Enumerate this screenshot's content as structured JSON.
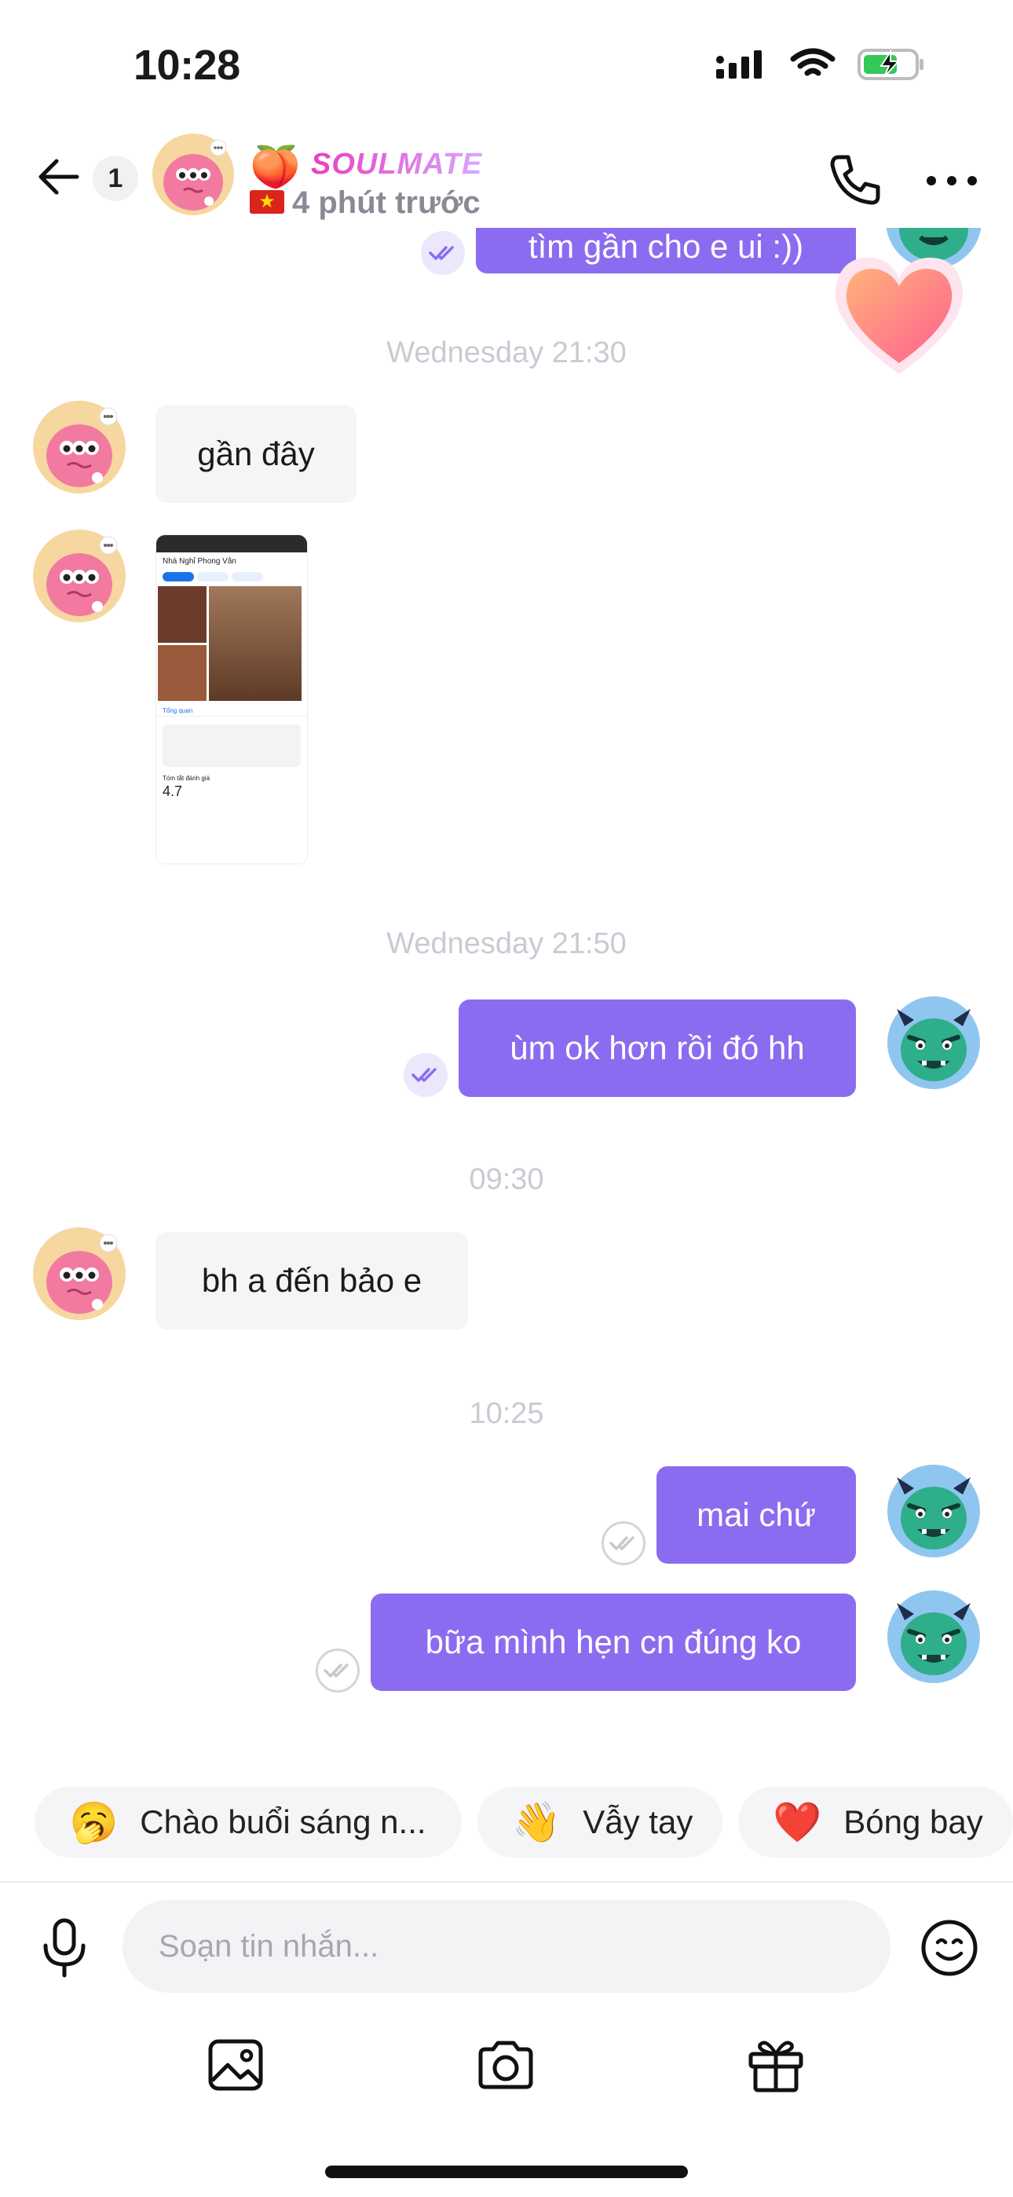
{
  "status_bar": {
    "time": "10:28"
  },
  "header": {
    "unread_count": "1",
    "app_brand": "SOULMATE",
    "peach_emoji": "🍑",
    "flag_emoji": "★",
    "last_seen": "4 phút trước"
  },
  "messages": {
    "partial_top_text": "tìm gần cho e ui :))",
    "timestamp_1": "Wednesday 21:30",
    "in_1": "gần đây",
    "shared_image": {
      "place_name": "Nhà Nghỉ Phong Vân",
      "rating": "4.7",
      "tab_overview": "Tổng quan",
      "section_reviews": "Tóm tắt đánh giá"
    },
    "timestamp_2": "Wednesday 21:50",
    "out_1": "ùm ok hơn rồi đó hh",
    "timestamp_3": "09:30",
    "in_2": "bh a đến bảo e",
    "timestamp_4": "10:25",
    "out_2": "mai chứ",
    "out_3": "bữa mình hẹn cn đúng ko"
  },
  "suggestions": [
    {
      "emoji": "🥱",
      "label": "Chào buổi sáng n..."
    },
    {
      "emoji": "👋",
      "label": "Vẫy tay"
    },
    {
      "emoji": "❤️",
      "label": "Bóng bay"
    }
  ],
  "composer": {
    "placeholder": "Soạn tin nhắn..."
  },
  "colors": {
    "outgoing_bubble": "#8b6cf0",
    "incoming_bubble": "#f5f5f7",
    "timestamp": "#c9cad3"
  },
  "icons": [
    "back-arrow-icon",
    "phone-icon",
    "more-icon",
    "double-check-icon",
    "mic-icon",
    "emoji-icon",
    "image-icon",
    "camera-icon",
    "gift-icon",
    "heart-sticker-icon"
  ]
}
